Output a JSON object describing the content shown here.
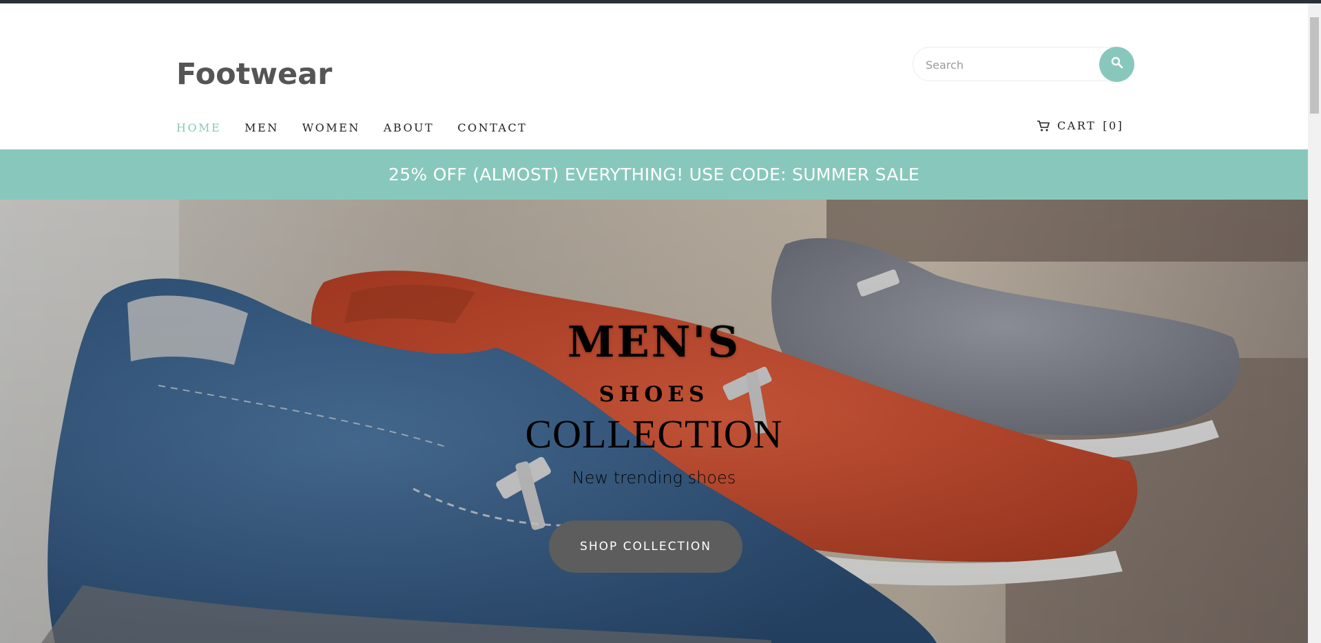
{
  "header": {
    "logo": "Footwear",
    "search": {
      "placeholder": "Search"
    }
  },
  "nav": {
    "items": [
      {
        "label": "HOME",
        "active": true
      },
      {
        "label": "MEN",
        "active": false
      },
      {
        "label": "WOMEN",
        "active": false
      },
      {
        "label": "ABOUT",
        "active": false
      },
      {
        "label": "CONTACT",
        "active": false
      }
    ],
    "cart_label": "CART",
    "cart_count": "[0]"
  },
  "promo": {
    "text": "25% OFF (ALMOST) EVERYTHING! USE CODE: SUMMER SALE"
  },
  "hero": {
    "title": "MEN'S",
    "subtitle": "SHOES",
    "collection": "COLLECTION",
    "tagline": "New trending shoes",
    "button": "SHOP COLLECTION"
  },
  "colors": {
    "accent": "#88c8bc",
    "text_dark": "#222222",
    "logo": "#555555",
    "button_bg": "#5d5d5d"
  },
  "icons": [
    "search-icon",
    "cart-icon"
  ]
}
